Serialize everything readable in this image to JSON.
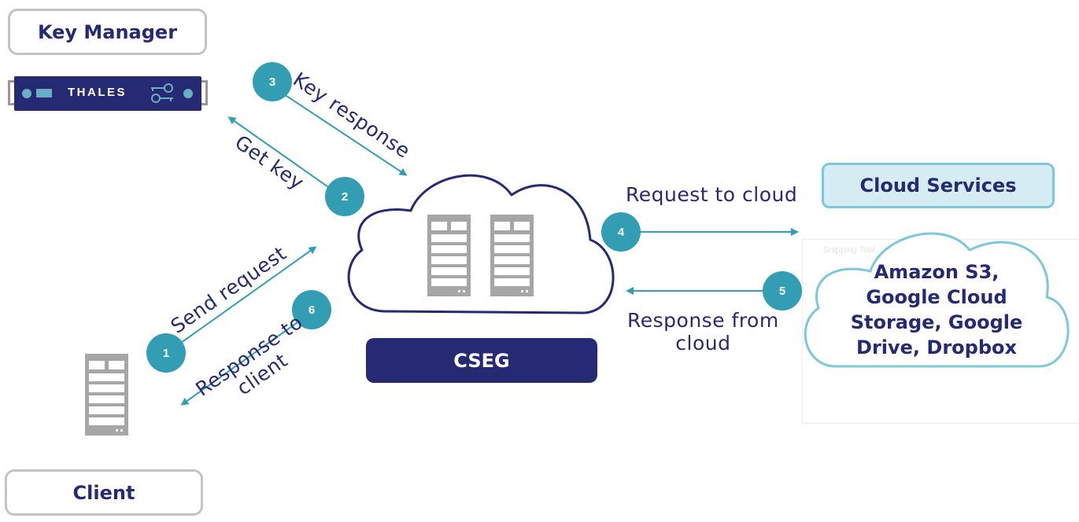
{
  "labels": {
    "key_manager": "Key Manager",
    "client": "Client",
    "cseg": "CSEG",
    "cloud_services": "Cloud Services",
    "device_brand": "THALES"
  },
  "cloud_services_list": [
    "Amazon S3,",
    "Google Cloud",
    "Storage, Google",
    "Drive, Dropbox"
  ],
  "overlay": {
    "snipping_tool_label": "Snipping Tool"
  },
  "steps": [
    {
      "number": "1",
      "label": "Send request"
    },
    {
      "number": "2",
      "label": "Get key"
    },
    {
      "number": "3",
      "label": "Key response"
    },
    {
      "number": "4",
      "label": "Request to cloud"
    },
    {
      "number": "5",
      "label": "Response from cloud"
    },
    {
      "number": "6",
      "label": "Response to client"
    }
  ],
  "step_label_lines": {
    "s5_line1": "Response from",
    "s5_line2": "cloud",
    "s6_line1": "Response to",
    "s6_line2": "client"
  },
  "colors": {
    "navy": "#262a72",
    "teal": "#339db3",
    "light_teal": "#7cc8d8",
    "gray": "#a6a6a6",
    "box_border": "#c3c3c3"
  }
}
